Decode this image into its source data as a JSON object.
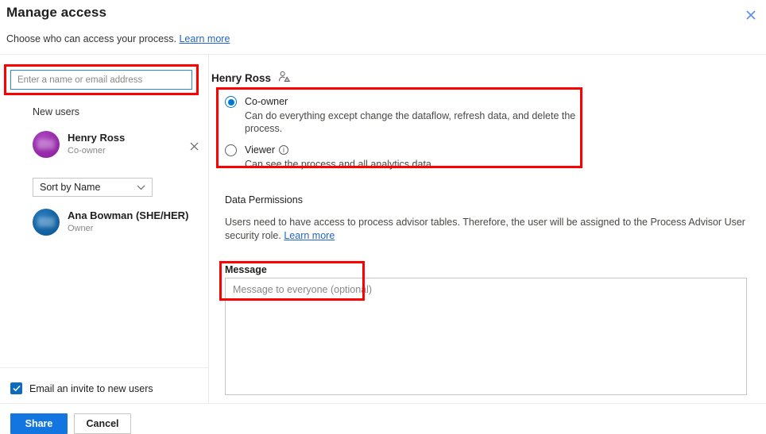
{
  "dialog": {
    "title": "Manage access",
    "subtitle_text": "Choose who can access your process.",
    "subtitle_link": "Learn more",
    "close_icon": "close-icon"
  },
  "left_panel": {
    "search": {
      "placeholder": "Enter a name or email address",
      "value": ""
    },
    "new_users_label": "New users",
    "new_users": [
      {
        "name": "Henry Ross",
        "role": "Co-owner",
        "avatar_color": "#9b2fae",
        "remove_icon": "close-icon"
      }
    ],
    "sort": {
      "selected": "Sort by Name",
      "chevron_icon": "chevron-down-icon"
    },
    "existing_users": [
      {
        "name": "Ana Bowman (SHE/HER)",
        "role": "Owner",
        "avatar_color": "#1668a8"
      }
    ],
    "email_invite": {
      "label": "Email an invite to new users",
      "checked": true,
      "check_icon": "check-icon"
    },
    "buttons": {
      "primary": "Share",
      "secondary": "Cancel"
    }
  },
  "right_panel": {
    "selected_user": "Henry Ross",
    "user_icon": "person-add-icon",
    "roles": [
      {
        "label": "Co-owner",
        "description": "Can do everything except change the dataflow, refresh data, and delete the process.",
        "selected": true,
        "has_info_icon": false
      },
      {
        "label": "Viewer",
        "description": "Can see the process and all analytics data.",
        "selected": false,
        "has_info_icon": true,
        "info_icon": "info-icon"
      }
    ],
    "data_permissions": {
      "title": "Data Permissions",
      "text": "Users need to have access to process advisor tables. Therefore, the user will be assigned to the Process Advisor User security role.",
      "link": "Learn more"
    },
    "message": {
      "title": "Message",
      "placeholder": "Message to everyone (optional)",
      "value": ""
    }
  },
  "annotations": {
    "accent_color": "#ff0000",
    "boxes": [
      "search-input",
      "role-radio-group",
      "message-placeholder"
    ]
  }
}
